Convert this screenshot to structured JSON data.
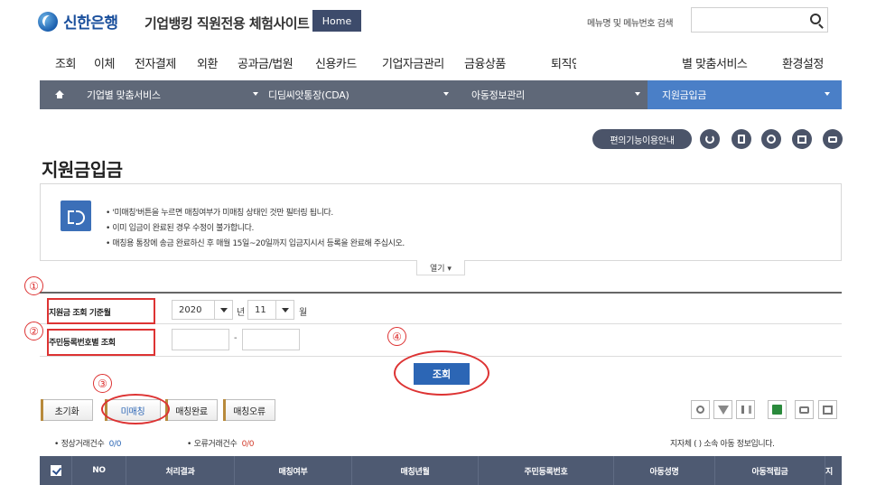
{
  "header": {
    "logo_text": "신한은행",
    "site_title": "기업뱅킹 직원전용 체험사이트",
    "home_label": "Home",
    "search_label": "메뉴명 및 메뉴번호 검색",
    "search_value": ""
  },
  "main_menu": [
    "조회",
    "이체",
    "전자결제",
    "외환",
    "공과금/법원",
    "신용카드",
    "기업자금관리",
    "금융상품",
    "퇴직연금"
  ],
  "main_menu_right": [
    "별 맞춤서비스",
    "환경설정"
  ],
  "breadcrumb": [
    "기업별 맞춤서비스",
    "디딤씨앗통장(CDA)",
    "아동정보관리",
    "지원금입금"
  ],
  "tools": {
    "guide_label": "편의기능이용안내",
    "icons": [
      "refresh-icon",
      "document-icon",
      "add-icon",
      "window-icon",
      "print-icon"
    ]
  },
  "page_title": "지원금입금",
  "notice": {
    "lines": [
      "• '미매칭'버튼을 누르면 매칭여부가 미매칭 상태인 것만 필터링 됩니다.",
      "• 이미 입금이 완료된 경우 수정이 불가합니다.",
      "• 매칭용 통장에 송금 완료하신 후 매월 15일~20일까지 입금지시서 등록을 완료해 주십시오."
    ],
    "more_label": "열기 ▾"
  },
  "form": {
    "base_month_label": "지원금 조회 기준월",
    "year_value": "2020",
    "year_unit": "년",
    "month_value": "11",
    "month_unit": "월",
    "rrn_label": "주민등록번호별 조회",
    "rrn_separator": "-",
    "search_button": "조회"
  },
  "actions": {
    "reset": "초기화",
    "unmatched": "미매칭",
    "matched": "매칭완료",
    "error": "매칭오류"
  },
  "counts": {
    "normal_label": "• 정상거래건수",
    "normal_value": "0/0",
    "error_label": "• 오류거래건수",
    "error_value": "0/0",
    "region_note": "지자체 ( ) 소속 아동 정보입니다."
  },
  "table": {
    "headers": [
      "NO",
      "처리결과",
      "매칭여부",
      "매칭년월",
      "주민등록번호",
      "아동성명",
      "아동적립금",
      "지"
    ]
  },
  "annotations": [
    "①",
    "②",
    "③",
    "④"
  ],
  "colors": {
    "brand_blue": "#1a4f9c",
    "nav_gray": "#5f6878",
    "active_blue": "#4a7fc7",
    "annotation_red": "#dd3333"
  }
}
